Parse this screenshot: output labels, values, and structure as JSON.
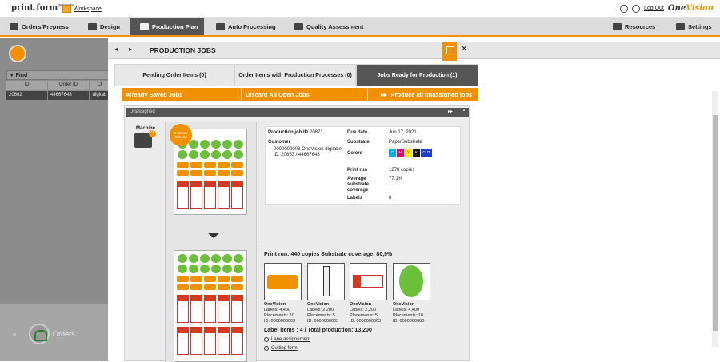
{
  "app": {
    "name": "print form",
    "name_sup": "generate",
    "workspace": "Workspace",
    "logout": "Log Out",
    "brand_a": "One",
    "brand_b": "Vision"
  },
  "nav": [
    {
      "label": "Orders/Prepress",
      "icon": "layers-icon"
    },
    {
      "label": "Design",
      "icon": "tools-icon"
    },
    {
      "label": "Production Plan",
      "icon": "plan-icon"
    },
    {
      "label": "Auto Processing",
      "icon": "auto-icon"
    },
    {
      "label": "Quality Assessment",
      "icon": "quality-icon"
    },
    {
      "label": "Resources",
      "icon": "wrench-icon"
    },
    {
      "label": "Settings",
      "icon": "gear-icon"
    }
  ],
  "left": {
    "find": "Find",
    "headers": [
      "ID",
      "Order ID",
      "Cl"
    ],
    "row": [
      "20662",
      "44667643",
      "digitab"
    ],
    "orders": "Orders"
  },
  "modal": {
    "title": "PRODUCTION JOBS",
    "tabs": [
      "Pending Order Items (0)",
      "Order Items with Production Processes (0)",
      "Jobs Ready for Production (1)"
    ],
    "actions": [
      "Already Saved Jobs",
      "Discard All Open Jobs",
      "Produce all unassigned jobs"
    ],
    "panel_title": "Unassigned",
    "machine": "Machine",
    "badge": "2 items / Column"
  },
  "job": {
    "id_label": "Production job ID",
    "id": "20871",
    "customer_label": "Customer",
    "customer": "0000000003 OneVision digilabel",
    "customer_id": "ID: 20653 / 44667643",
    "due_label": "Due date",
    "due": "Jun 17, 2021",
    "substrate_label": "Substrate",
    "substrate": "PaperSubstrate",
    "colors_label": "Colors",
    "colors": [
      {
        "l": "C",
        "c": "#00aeef"
      },
      {
        "l": "M",
        "c": "#e5007e"
      },
      {
        "l": "Y",
        "c": "#ffed00"
      },
      {
        "l": "K",
        "c": "#111111"
      },
      {
        "l": "CUT",
        "c": "#1e40c8"
      }
    ],
    "run_label": "Print run",
    "run": "1278 copies",
    "cov_label": "Average substrate coverage",
    "cov": "77.1%",
    "labels_label": "Labels",
    "labels": "8"
  },
  "run": {
    "summary": "Print run: 440 copies   Substrate coverage: 80,9%",
    "items": [
      {
        "brand": "OneVision",
        "labels": "Labels: 4,400",
        "placements": "Placements: 10",
        "id": "ID: 0000000003"
      },
      {
        "brand": "OneVision",
        "labels": "Labels: 2,200",
        "placements": "Placements: 5",
        "id": "ID: 0000000003"
      },
      {
        "brand": "OneVision",
        "labels": "Labels: 2,200",
        "placements": "Placements: 5",
        "id": "ID: 0000000003"
      },
      {
        "brand": "OneVision",
        "labels": "Labels: 4,400",
        "placements": "Placements: 10",
        "id": "ID: 0000000003"
      }
    ],
    "totals": "Label items : 4 / Total production: 13,200",
    "lane": "Lane assignement",
    "cutting": "Cutting form"
  }
}
